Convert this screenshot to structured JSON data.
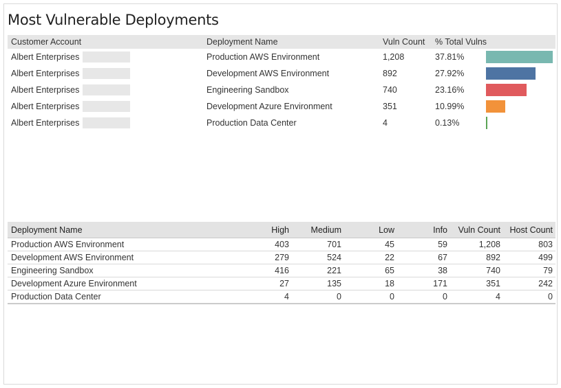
{
  "title": "Most Vulnerable Deployments",
  "colors": {
    "bars": [
      "#79b8b0",
      "#4e74a3",
      "#e05a5d",
      "#f2923a",
      "#5aa455"
    ]
  },
  "top_table": {
    "headers": {
      "account": "Customer Account",
      "deployment": "Deployment Name",
      "count": "Vuln Count",
      "pct": "% Total Vulns"
    },
    "rows": [
      {
        "account": "Albert Enterprises",
        "deployment": "Production AWS Environment",
        "count": "1,208",
        "pct": "37.81%",
        "pct_value": 37.81
      },
      {
        "account": "Albert Enterprises",
        "deployment": "Development AWS Environment",
        "count": "892",
        "pct": "27.92%",
        "pct_value": 27.92
      },
      {
        "account": "Albert Enterprises",
        "deployment": "Engineering Sandbox",
        "count": "740",
        "pct": "23.16%",
        "pct_value": 23.16
      },
      {
        "account": "Albert Enterprises",
        "deployment": "Development Azure Environment",
        "count": "351",
        "pct": "10.99%",
        "pct_value": 10.99
      },
      {
        "account": "Albert Enterprises",
        "deployment": "Production Data Center",
        "count": "4",
        "pct": "0.13%",
        "pct_value": 0.13
      }
    ]
  },
  "bottom_table": {
    "headers": {
      "name": "Deployment Name",
      "high": "High",
      "medium": "Medium",
      "low": "Low",
      "info": "Info",
      "vuln": "Vuln Count",
      "host": "Host Count"
    },
    "rows": [
      {
        "name": "Production AWS Environment",
        "high": "403",
        "medium": "701",
        "low": "45",
        "info": "59",
        "vuln": "1,208",
        "host": "803"
      },
      {
        "name": "Development AWS Environment",
        "high": "279",
        "medium": "524",
        "low": "22",
        "info": "67",
        "vuln": "892",
        "host": "499"
      },
      {
        "name": "Engineering Sandbox",
        "high": "416",
        "medium": "221",
        "low": "65",
        "info": "38",
        "vuln": "740",
        "host": "79"
      },
      {
        "name": "Development Azure Environment",
        "high": "27",
        "medium": "135",
        "low": "18",
        "info": "171",
        "vuln": "351",
        "host": "242"
      },
      {
        "name": "Production Data Center",
        "high": "4",
        "medium": "0",
        "low": "0",
        "info": "0",
        "vuln": "4",
        "host": "0"
      }
    ]
  }
}
